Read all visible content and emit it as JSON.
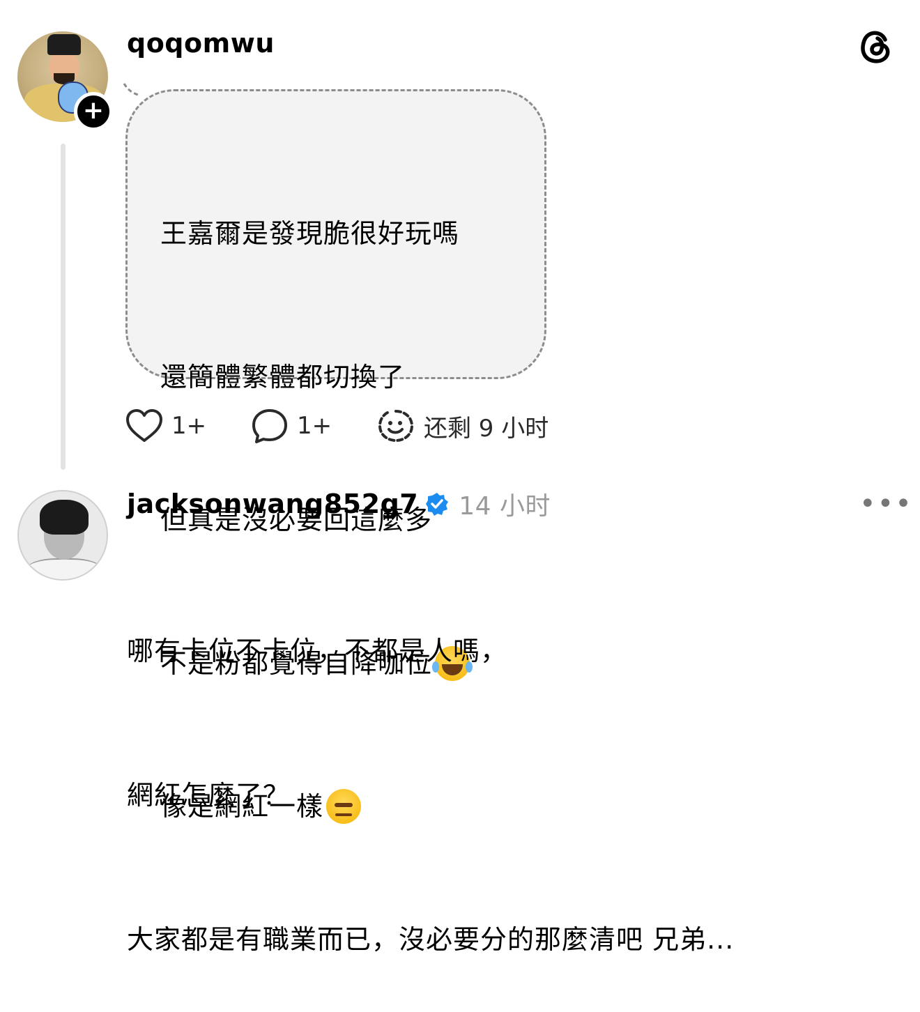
{
  "post": {
    "username": "qoqomwu",
    "follow_symbol": "+",
    "lines": [
      "王嘉爾是發現脆很好玩嗎",
      "還簡體繁體都切換了",
      "但真是沒必要回這麼多",
      "不是粉都覺得自降咖位",
      "像是網紅一樣"
    ],
    "line_emojis": [
      "",
      "",
      "",
      "face-with-tears-of-joy",
      "face-with-raised-eyebrow"
    ],
    "likes": "1+",
    "replies": "1+",
    "expires": "还剩 9 小时"
  },
  "reply": {
    "username": "jacksonwang852g7",
    "time_ago": "14 小时",
    "more": "•••",
    "lines": [
      "哪有卡位不卡位，不都是人嗎，",
      "網紅怎麼了？",
      "大家都是有職業而已，沒必要分的那麼清吧 兄弟..."
    ]
  },
  "icons": [
    "threads-logo",
    "plus-icon",
    "heart-icon",
    "reply-icon",
    "ephemeral-icon",
    "verified-icon",
    "more-icon"
  ],
  "colors": {
    "bubble_bg": "#f3f3f3",
    "bubble_border": "#8c8c8c",
    "verified": "#1d8cf0",
    "muted": "#9a9a9a"
  }
}
